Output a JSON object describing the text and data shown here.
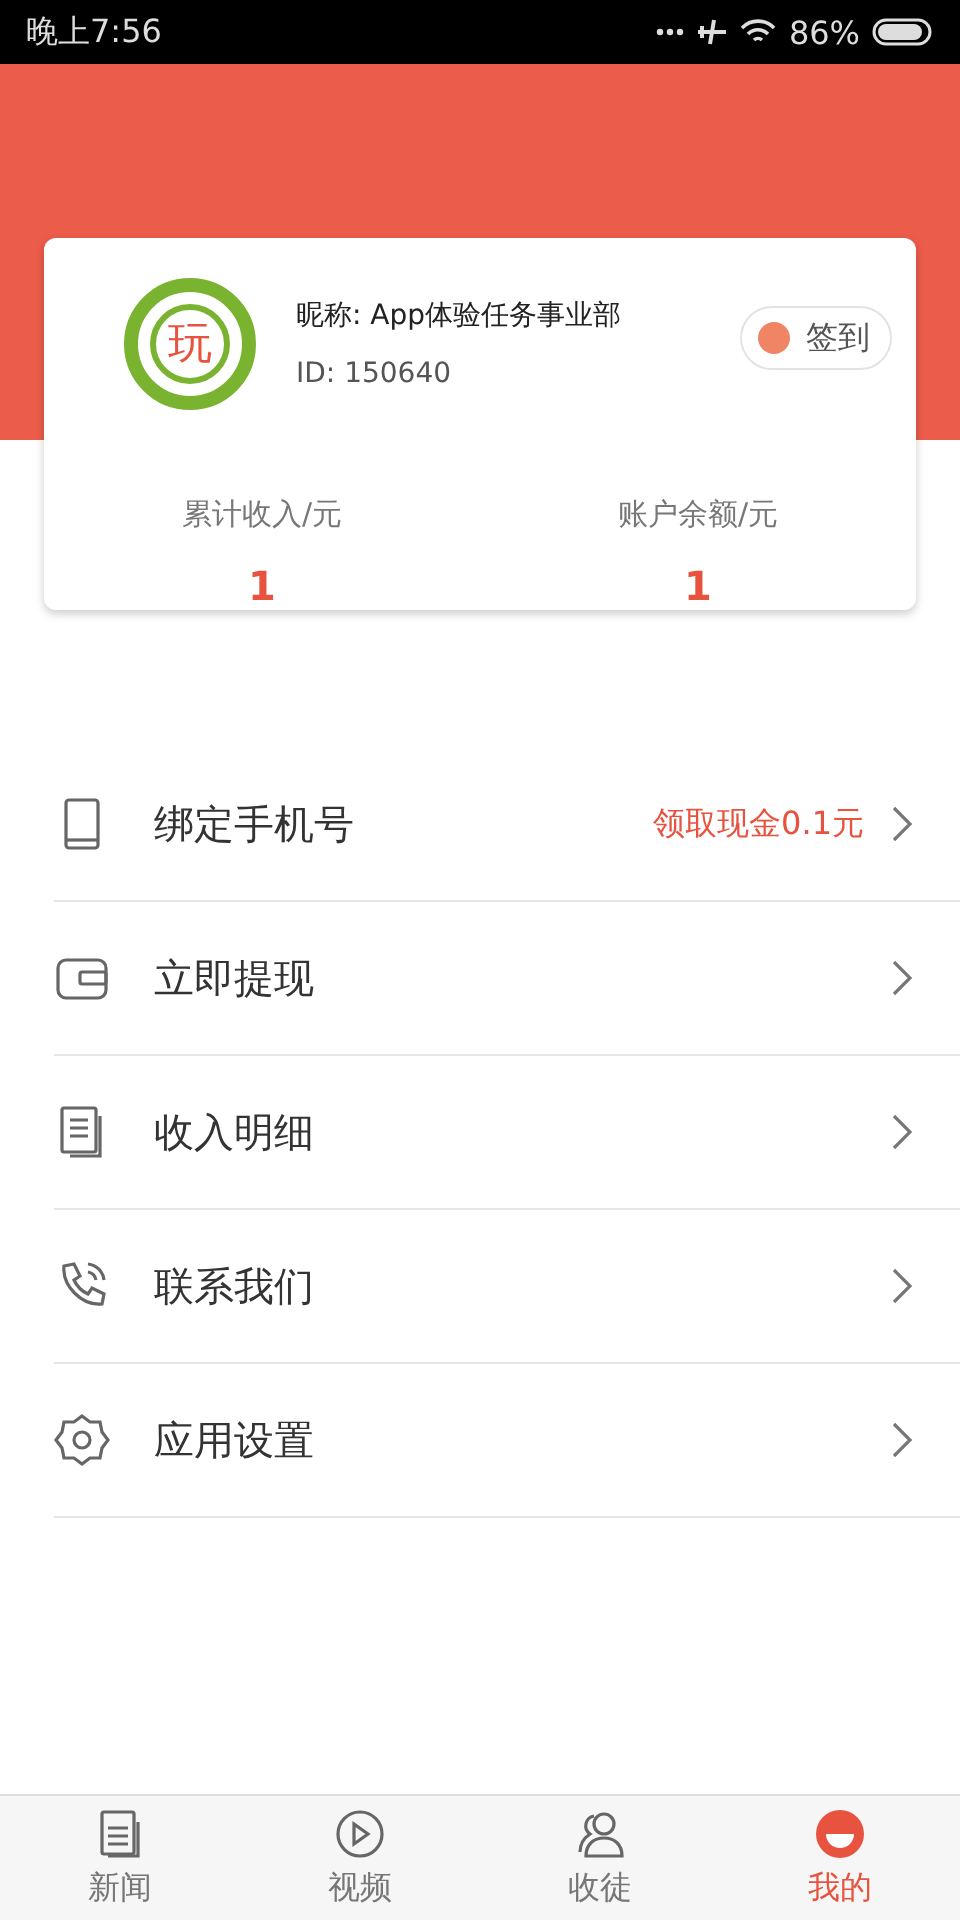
{
  "status_bar": {
    "time": "晚上7:56",
    "battery": "86%"
  },
  "profile": {
    "logo_text": "玩",
    "nickname": "昵称: App体验任务事业部",
    "id": "ID:  150640",
    "checkin_button": "签到"
  },
  "stats": [
    {
      "label": "累计收入/元",
      "value": "1"
    },
    {
      "label": "账户余额/元",
      "value": "1"
    }
  ],
  "menu": [
    {
      "label": "绑定手机号",
      "note": "领取现金0.1元"
    },
    {
      "label": "立即提现"
    },
    {
      "label": "收入明细"
    },
    {
      "label": "联系我们"
    },
    {
      "label": "应用设置"
    }
  ],
  "tabs": [
    {
      "label": "新闻",
      "selected": false
    },
    {
      "label": "视频",
      "selected": false
    },
    {
      "label": "收徒",
      "selected": false
    },
    {
      "label": "我的",
      "selected": true
    }
  ]
}
